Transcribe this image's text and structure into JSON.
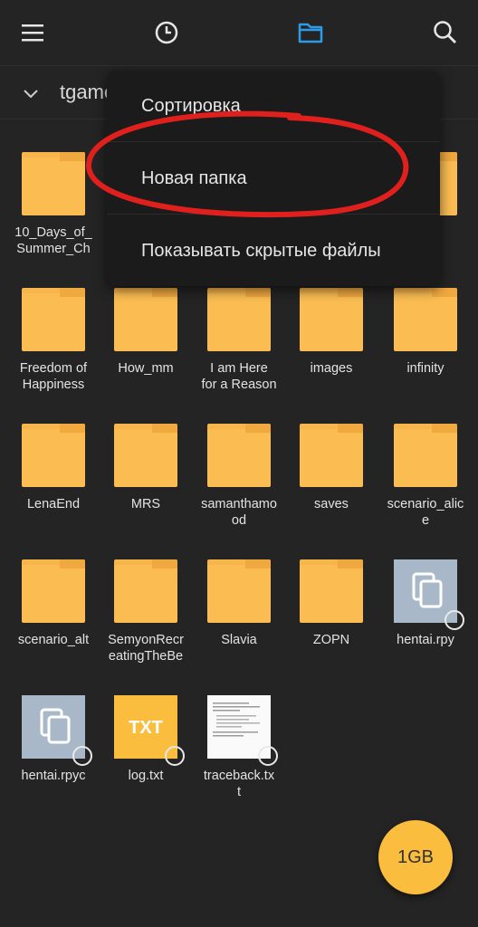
{
  "topbar": {
    "icons": [
      "menu-icon",
      "history-icon",
      "folder-icon",
      "search-icon"
    ],
    "accent": "#2f9be8"
  },
  "path": {
    "current": "tgame"
  },
  "menu": {
    "items": [
      "Сортировка",
      "Новая папка",
      "Показывать скрытые файлы"
    ],
    "annotation_color": "#e0201c"
  },
  "files": [
    {
      "name": "10_Days_of_\nSummer_Ch",
      "type": "folder"
    },
    {
      "name": "Freedom of\nHappiness",
      "type": "folder"
    },
    {
      "name": "How_mm",
      "type": "folder"
    },
    {
      "name": "I am Here\nfor a Reason",
      "type": "folder"
    },
    {
      "name": "images",
      "type": "folder"
    },
    {
      "name": "infinity",
      "type": "folder"
    },
    {
      "name": "LenaEnd",
      "type": "folder"
    },
    {
      "name": "MRS",
      "type": "folder"
    },
    {
      "name": "samanthamo\nod",
      "type": "folder"
    },
    {
      "name": "saves",
      "type": "folder"
    },
    {
      "name": "scenario_alic\ne",
      "type": "folder"
    },
    {
      "name": "scenario_alt",
      "type": "folder"
    },
    {
      "name": "SemyonRecr\neatingTheBe",
      "type": "folder"
    },
    {
      "name": "Slavia",
      "type": "folder"
    },
    {
      "name": "ZOPN",
      "type": "folder"
    },
    {
      "name": "hentai.rpy",
      "type": "doc"
    },
    {
      "name": "hentai.rpyc",
      "type": "doc"
    },
    {
      "name": "log.txt",
      "type": "txt",
      "badge": "TXT"
    },
    {
      "name": "traceback.tx\nt",
      "type": "preview"
    }
  ],
  "fab": {
    "label": "1GB",
    "color": "#fbbd3e"
  }
}
